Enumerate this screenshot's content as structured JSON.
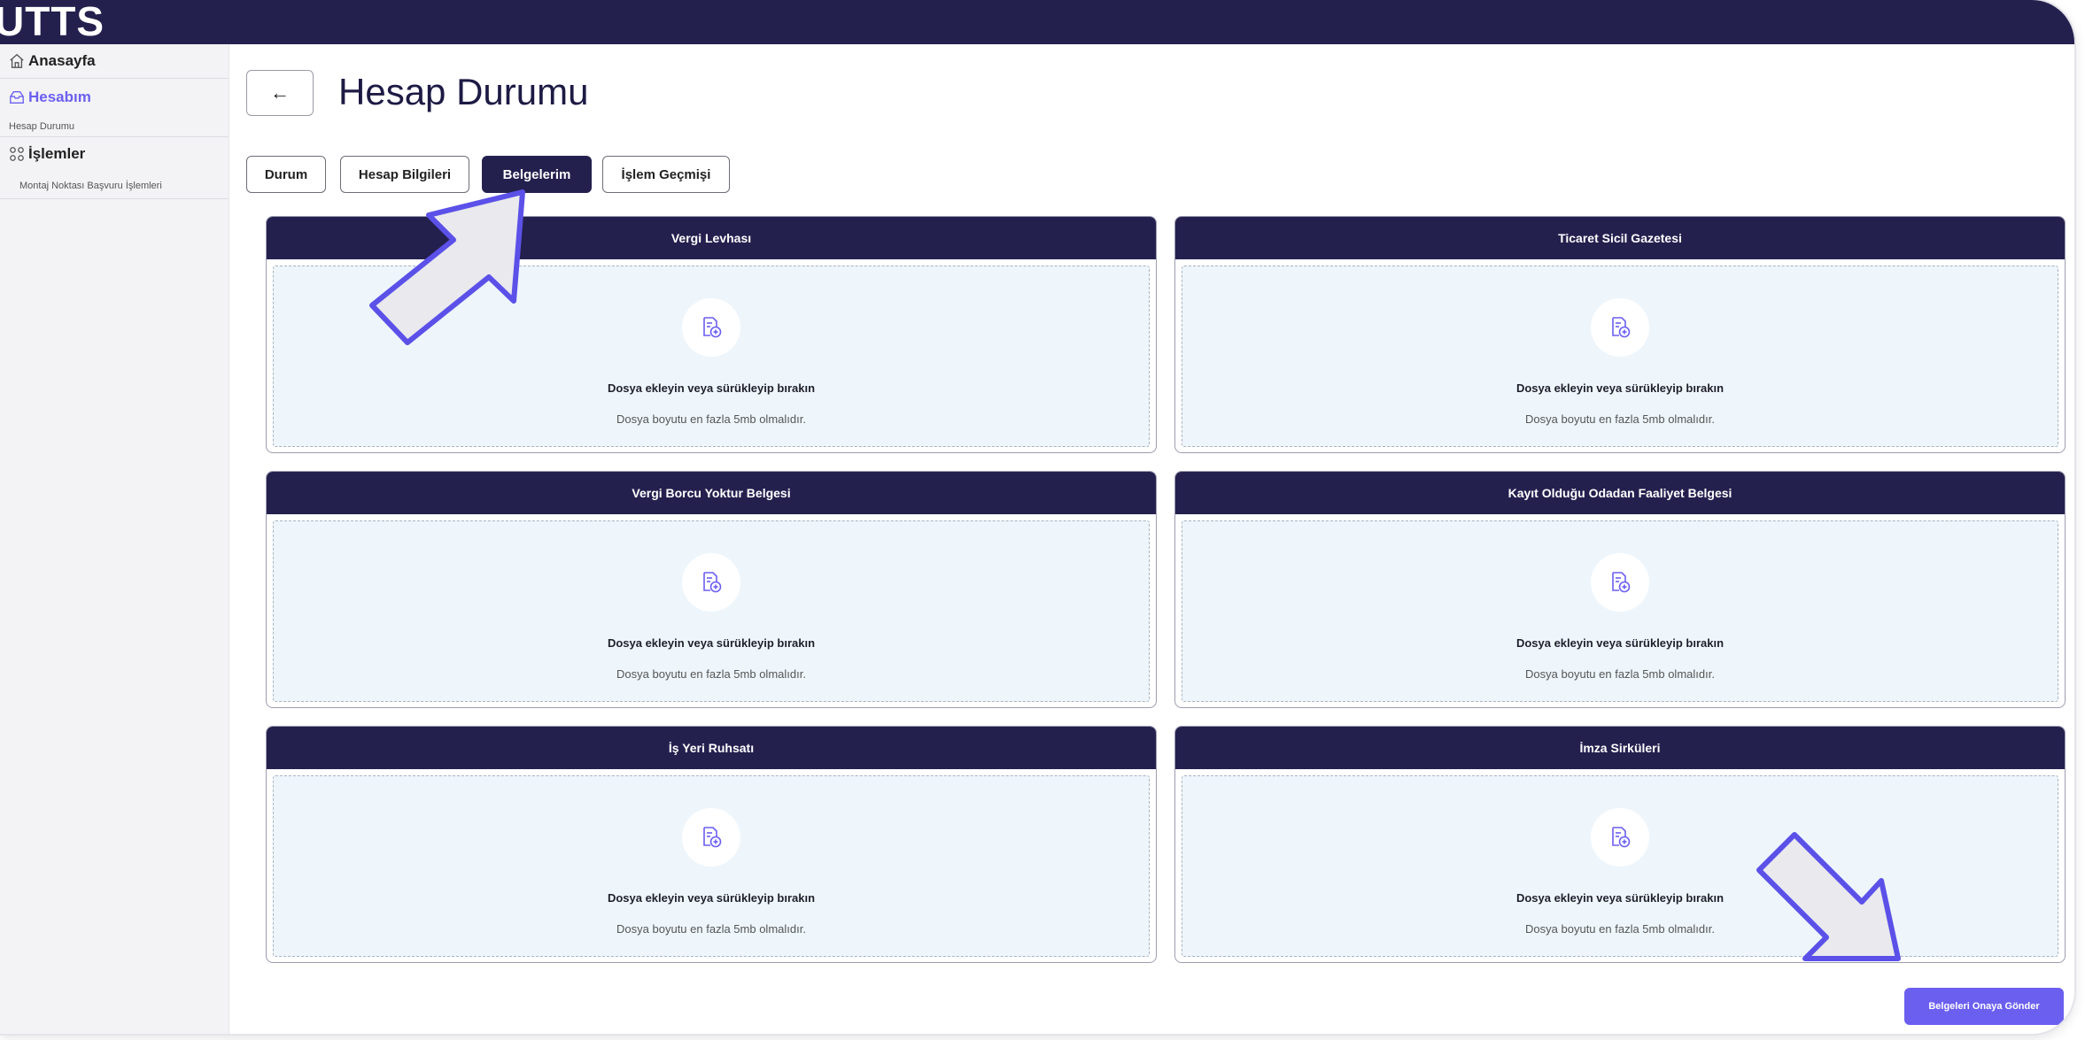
{
  "app": {
    "logo": "UTTS"
  },
  "sidebar": {
    "items": [
      {
        "label": "Anasayfa",
        "icon": "home-icon"
      },
      {
        "label": "Hesabım",
        "icon": "mail-box-icon",
        "active": true,
        "sub": "Hesap Durumu"
      },
      {
        "label": "İşlemler",
        "icon": "share-nodes-icon",
        "sub": "Montaj Noktası Başvuru İşlemleri"
      }
    ]
  },
  "page": {
    "title": "Hesap Durumu",
    "back_icon": "arrow-left-icon"
  },
  "tabs": [
    {
      "label": "Durum"
    },
    {
      "label": "Hesap Bilgileri"
    },
    {
      "label": "Belgelerim",
      "active": true
    },
    {
      "label": "İşlem Geçmişi"
    }
  ],
  "upload": {
    "title": "Dosya ekleyin veya sürükleyip bırakın",
    "hint": "Dosya boyutu en fazla 5mb olmalıdır.",
    "icon": "file-add-icon"
  },
  "documents": [
    {
      "title": "Vergi Levhası"
    },
    {
      "title": "Ticaret Sicil Gazetesi"
    },
    {
      "title": "Vergi Borcu Yoktur Belgesi"
    },
    {
      "title": "Kayıt Olduğu Odadan Faaliyet Belgesi"
    },
    {
      "title": "İş Yeri Ruhsatı"
    },
    {
      "title": "İmza Sirküleri"
    }
  ],
  "actions": {
    "submit_label": "Belgeleri Onaya Gönder"
  },
  "colors": {
    "navy": "#24204e",
    "accent": "#6b5ff0",
    "drop_bg": "#eef6fc",
    "arrow_stroke": "#5b51e8",
    "arrow_fill": "#e9e9ee"
  }
}
